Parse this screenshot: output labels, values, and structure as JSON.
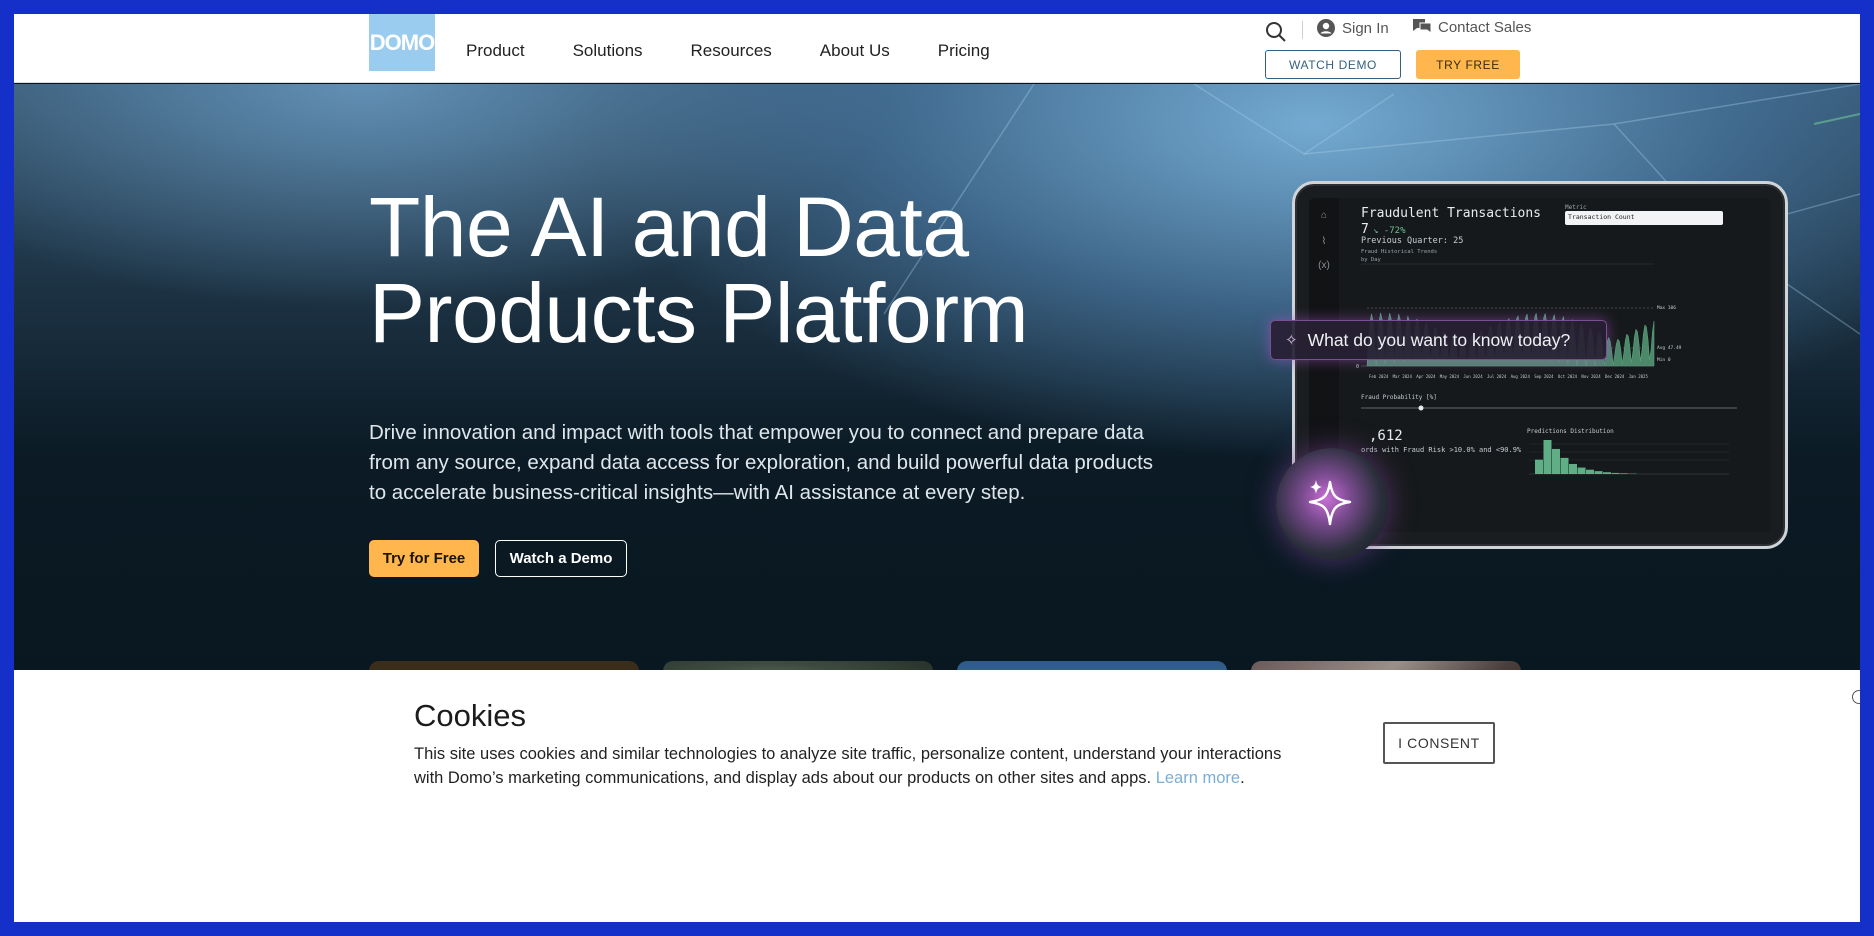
{
  "header": {
    "logo_text": "DOMO",
    "nav": [
      "Product",
      "Solutions",
      "Resources",
      "About Us",
      "Pricing"
    ],
    "utility": {
      "sign_in": "Sign In",
      "contact_sales": "Contact Sales"
    },
    "watch_demo": "WATCH DEMO",
    "try_free": "TRY FREE"
  },
  "hero": {
    "title_line1": "The AI and Data",
    "title_line2": "Products Platform",
    "subtitle": "Drive innovation and impact with tools that empower you to connect and prepare data from any source, expand data access for exploration, and build powerful data products to accelerate business-critical insights—with AI assistance at every step.",
    "try_button": "Try for Free",
    "watch_button": "Watch a Demo",
    "ask_prompt": "What do you want to know today?"
  },
  "dashboard": {
    "title": "Fraudulent Transactions",
    "value": "7",
    "delta": "↘ -72%",
    "previous": "Previous Quarter: 25",
    "trend_title": "Fraud Historical Trends",
    "trend_sub": "by Day",
    "metric_label": "Metric",
    "metric_value": "Transaction Count",
    "fraud_prob_label": "Fraud Probability [%]",
    "big_value": ",612",
    "records_text": "ords with Fraud Risk >10.0% and <90.9%",
    "dist_label": "Predictions Distribution",
    "month_labels": [
      "Feb 2024",
      "Mar 2024",
      "Apr 2024",
      "May 2024",
      "Jun 2024",
      "Jul 2024",
      "Aug 2024",
      "Sep 2024",
      "Oct 2024",
      "Nov 2024",
      "Dec 2024",
      "Jan 2025"
    ],
    "y_labels": [
      "100",
      "50",
      "0"
    ],
    "ref_labels": [
      "Max 106",
      "Avg 47.49",
      "Min 0"
    ],
    "dist_values": [
      40,
      95,
      70,
      45,
      28,
      18,
      12,
      8,
      5,
      3,
      2,
      1
    ]
  },
  "cookie": {
    "title": "Cookies",
    "text": "This site uses cookies and similar technologies to analyze site traffic, personalize content, understand your interactions with Domo’s marketing communications, and display ads about our products on other sites and apps.",
    "link": "Learn more",
    "period": ".",
    "consent": "I CONSENT"
  },
  "colors": {
    "accent_yellow": "#ffb74d",
    "brand_blue": "#99ccee",
    "chart_green": "#5fae86"
  }
}
